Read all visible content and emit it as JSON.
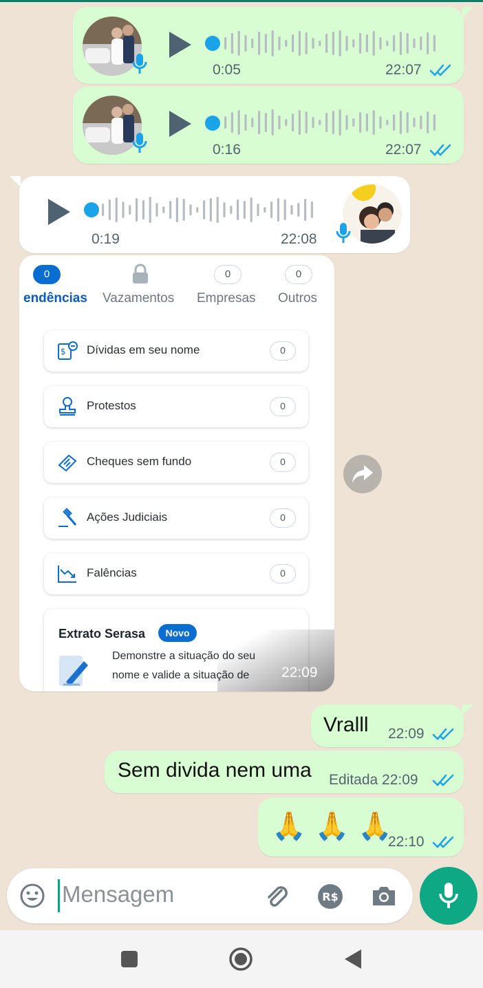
{
  "voice_messages": [
    {
      "duration": "0:05",
      "time": "22:07"
    },
    {
      "duration": "0:16",
      "time": "22:07"
    },
    {
      "duration": "0:19",
      "time": "22:08"
    }
  ],
  "shared_card": {
    "tabs": [
      {
        "label": "endências",
        "count": "0",
        "active": true
      },
      {
        "label": "Vazamentos",
        "count": "",
        "locked": true
      },
      {
        "label": "Empresas",
        "count": "0"
      },
      {
        "label": "Outros",
        "count": "0"
      }
    ],
    "items": [
      {
        "label": "Dívidas em seu nome",
        "count": "0",
        "icon": "debt-icon"
      },
      {
        "label": "Protestos",
        "count": "0",
        "icon": "stamp-icon"
      },
      {
        "label": "Cheques sem fundo",
        "count": "0",
        "icon": "check-icon"
      },
      {
        "label": "Ações Judiciais",
        "count": "0",
        "icon": "gavel-icon"
      },
      {
        "label": "Falências",
        "count": "0",
        "icon": "chart-down-icon"
      }
    ],
    "extrato": {
      "title": "Extrato Serasa",
      "badge": "Novo",
      "line1": "Demonstre a situação do seu",
      "line2": "nome e valide a situação de"
    },
    "time": "22:09"
  },
  "text_messages": [
    {
      "text": "Vralll",
      "meta": "22:09"
    },
    {
      "text": "Sem divida nem uma",
      "meta": "Editada 22:09"
    },
    {
      "text": "🙏 🙏 🙏",
      "meta": "22:10"
    }
  ],
  "composer": {
    "placeholder": "Mensagem"
  },
  "colors": {
    "out_bubble": "#d9fdd3",
    "in_bubble": "#ffffff",
    "accent": "#0fa884",
    "read_ticks": "#1aa3e8",
    "serasa_blue": "#0a6ed1"
  }
}
